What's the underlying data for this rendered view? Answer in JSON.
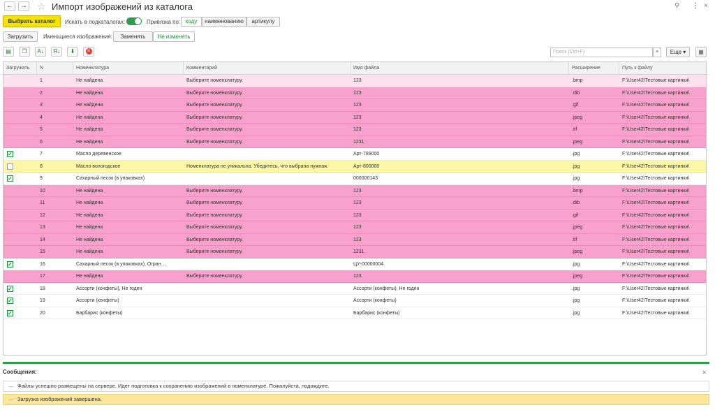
{
  "window": {
    "title": "Импорт изображений из каталога",
    "back_glyph": "←",
    "forward_glyph": "→",
    "star_glyph": "☆",
    "link_glyph": "⚲",
    "more_glyph": "⋮",
    "close_glyph": "×"
  },
  "controls": {
    "select_catalog": "Выбрать каталог",
    "search_subfolders_label": "Искать в подкаталогах:",
    "binding_label": "Привязка по:",
    "binding_options": [
      "коду",
      "наименованию",
      "артикулу"
    ],
    "load_button": "Загрузить",
    "existing_images_label": "Имеющиеся изображения:",
    "replace_button": "Заменять",
    "keep_button": "Не изменять"
  },
  "toolbar": {
    "search_placeholder": "Поиск (Ctrl+F)",
    "search_clear": "×",
    "more_button": "Еще ▾",
    "icons": [
      "▤",
      "❐",
      "A↓",
      "Я↓",
      "⬇",
      "✕"
    ],
    "settings_glyph": "▦"
  },
  "table": {
    "columns": [
      "Загружать",
      "N",
      "Номенклатура",
      "Комментарий",
      "Имя файла",
      "Расширение",
      "Путь к файлу"
    ],
    "rows": [
      {
        "state": "pinklight",
        "checked": null,
        "n": "1",
        "item": "Не найдена",
        "comment": "Выберите номенклатуру.",
        "file": "123",
        "ext": ".bmp",
        "path": "F:\\User42\\Тестовые картинки\\"
      },
      {
        "state": "pink",
        "checked": null,
        "n": "2",
        "item": "Не найдена",
        "comment": "Выберите номенклатуру.",
        "file": "123",
        "ext": ".dib",
        "path": "F:\\User42\\Тестовые картинки\\"
      },
      {
        "state": "pink",
        "checked": null,
        "n": "3",
        "item": "Не найдена",
        "comment": "Выберите номенклатуру.",
        "file": "123",
        "ext": ".gif",
        "path": "F:\\User42\\Тестовые картинки\\"
      },
      {
        "state": "pink",
        "checked": null,
        "n": "4",
        "item": "Не найдена",
        "comment": "Выберите номенклатуру.",
        "file": "123",
        "ext": ".jpeg",
        "path": "F:\\User42\\Тестовые картинки\\"
      },
      {
        "state": "pink",
        "checked": null,
        "n": "5",
        "item": "Не найдена",
        "comment": "Выберите номенклатуру.",
        "file": "123",
        "ext": ".tif",
        "path": "F:\\User42\\Тестовые картинки\\"
      },
      {
        "state": "pink",
        "checked": null,
        "n": "6",
        "item": "Не найдена",
        "comment": "Выберите номенклатуру.",
        "file": "1231",
        "ext": ".jpeg",
        "path": "F:\\User42\\Тестовые картинки\\"
      },
      {
        "state": "white",
        "checked": true,
        "n": "7",
        "item": "Масло деревенское",
        "comment": "",
        "file": "Арт-789000",
        "ext": ".jpg",
        "path": "F:\\User42\\Тестовые картинки\\"
      },
      {
        "state": "yellow",
        "checked": false,
        "n": "8",
        "item": "Масло вологодское",
        "comment": "Номенклатура не уникальна. Убедитесь, что выбрана нужная.",
        "file": "Арт-800000",
        "ext": ".jpg",
        "path": "F:\\User42\\Тестовые картинки\\"
      },
      {
        "state": "white",
        "checked": true,
        "n": "9",
        "item": "Сахарный песок (в упаковках)",
        "comment": "",
        "file": "000000143",
        "ext": ".jpg",
        "path": "F:\\User42\\Тестовые картинки\\"
      },
      {
        "state": "pink",
        "checked": null,
        "n": "10",
        "item": "Не найдена",
        "comment": "Выберите номенклатуру.",
        "file": "123",
        "ext": ".bmp",
        "path": "F:\\User42\\Тестовые картинки\\"
      },
      {
        "state": "pink",
        "checked": null,
        "n": "11",
        "item": "Не найдена",
        "comment": "Выберите номенклатуру.",
        "file": "123",
        "ext": ".dib",
        "path": "F:\\User42\\Тестовые картинки\\"
      },
      {
        "state": "pink",
        "checked": null,
        "n": "12",
        "item": "Не найдена",
        "comment": "Выберите номенклатуру.",
        "file": "123",
        "ext": ".gif",
        "path": "F:\\User42\\Тестовые картинки\\"
      },
      {
        "state": "pink",
        "checked": null,
        "n": "13",
        "item": "Не найдена",
        "comment": "Выберите номенклатуру.",
        "file": "123",
        "ext": ".jpeg",
        "path": "F:\\User42\\Тестовые картинки\\"
      },
      {
        "state": "pink",
        "checked": null,
        "n": "14",
        "item": "Не найдена",
        "comment": "Выберите номенклатуру.",
        "file": "123",
        "ext": ".tif",
        "path": "F:\\User42\\Тестовые картинки\\"
      },
      {
        "state": "pink",
        "checked": null,
        "n": "15",
        "item": "Не найдена",
        "comment": "Выберите номенклатуру.",
        "file": "1231",
        "ext": ".jpeg",
        "path": "F:\\User42\\Тестовые картинки\\"
      },
      {
        "state": "white",
        "checked": true,
        "n": "16",
        "item": "Сахарный песок (в упаковках), Огран…",
        "comment": "",
        "file": "ЦУ-00000004",
        "ext": ".jpg",
        "path": "F:\\User42\\Тестовые картинки\\"
      },
      {
        "state": "pink",
        "checked": null,
        "n": "17",
        "item": "Не найдена",
        "comment": "Выберите номенклатуру.",
        "file": "123",
        "ext": ".jpeg",
        "path": "F:\\User42\\Тестовые картинки\\"
      },
      {
        "state": "white",
        "checked": true,
        "n": "18",
        "item": "Ассорти (конфеты), Не годен",
        "comment": "",
        "file": "Ассорти (конфеты), Не годен",
        "ext": ".jpg",
        "path": "F:\\User42\\Тестовые картинки\\"
      },
      {
        "state": "white",
        "checked": true,
        "n": "19",
        "item": "Ассорти (конфеты)",
        "comment": "",
        "file": "Ассорти (конфеты)",
        "ext": ".jpg",
        "path": "F:\\User42\\Тестовые картинки\\"
      },
      {
        "state": "white",
        "checked": true,
        "n": "20",
        "item": "Барбарис (конфеты)",
        "comment": "",
        "file": "Барбарис (конфеты)",
        "ext": ".jpg",
        "path": "F:\\User42\\Тестовые картинки\\"
      }
    ]
  },
  "messages": {
    "title": "Сообщения:",
    "close_glyph": "×",
    "dash": "—",
    "items": [
      "Файлы успешно размещены на сервере. Идет подготовка к сохранению изображений в номенклатуре. Пожалуйста, подождите.",
      "Загрузка изображений завершена."
    ]
  },
  "colors": {
    "accent_green": "#2e9c4a",
    "button_yellow": "#f5e300",
    "row_pink": "#f7a1cc",
    "row_yellow": "#fbf7a6",
    "message_yellow": "#fbe79b"
  }
}
